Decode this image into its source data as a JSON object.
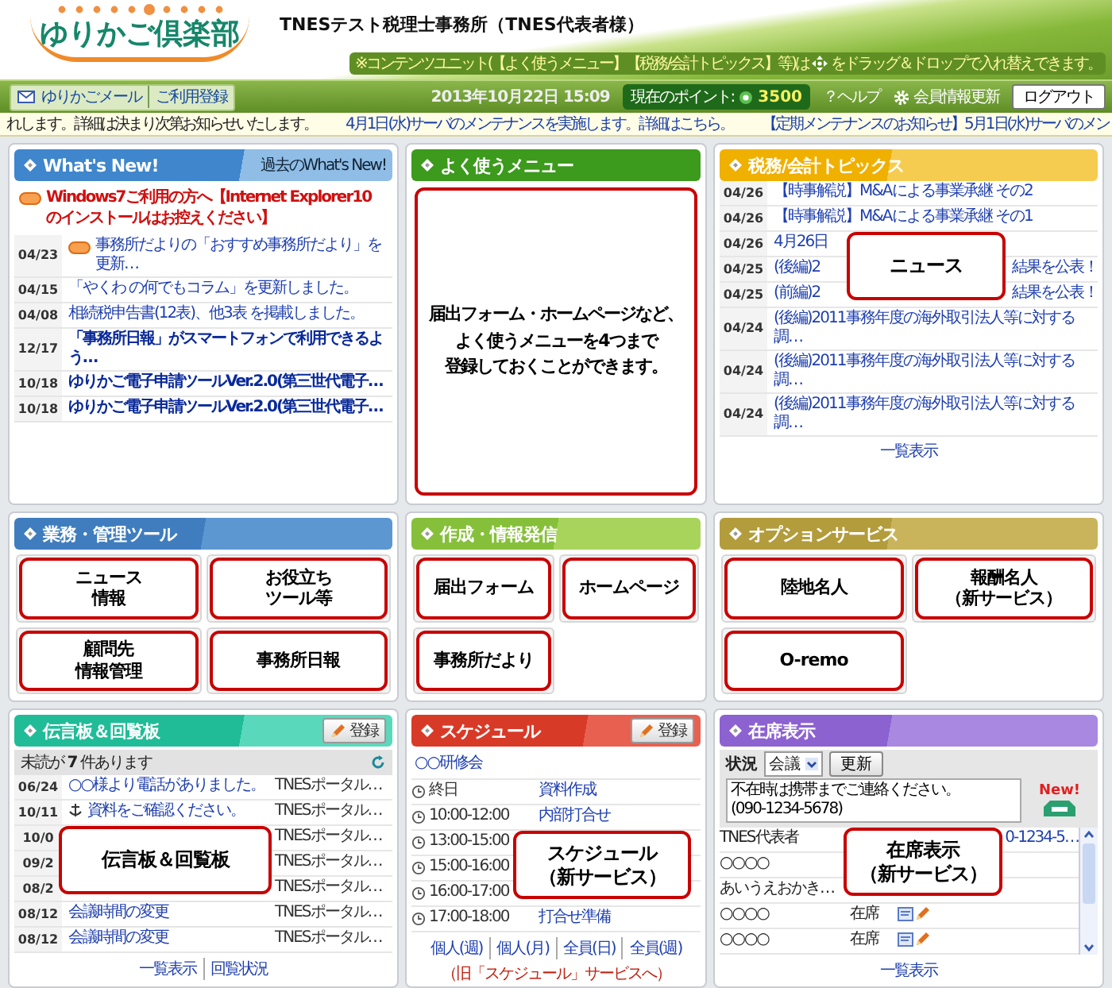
{
  "header": {
    "logo": "ゆりかご倶楽部",
    "office": "TNESテスト税理士事務所（TNES代表者様）",
    "notice_before": "※コンテンツユニット(【よく使うメニュー】【税務/会計トピックス】等)は",
    "notice_after": "をドラッグ＆ドロップで入れ替えできます。"
  },
  "nav": {
    "mail": "ゆりかごメール",
    "register": "ご利用登録",
    "datetime": "2013年10月22日 15:09",
    "points_label": "現在のポイント:",
    "points": "3500",
    "help": "？ヘルプ",
    "settings": "会員情報更新",
    "logout": "ログアウト"
  },
  "ticker": [
    {
      "text": "れします。詳細は決まり次第お知らせいたします。",
      "link": false
    },
    {
      "text": "4月1日(水)サーバのメンテナンスを実施します。詳細はこちら。",
      "link": true
    },
    {
      "text": "【定期メンテナンスのお知らせ】5月1日(水)サーバのメン",
      "link": true
    }
  ],
  "panels": [
    {
      "kind": "news",
      "title": "What's New!",
      "link": "過去のWhat's New!",
      "alert": {
        "text": "Windows7ご利用の方へ【Internet Explorer10 のインストールはお控えください】",
        "new": true
      },
      "rows": [
        {
          "date": "04/23",
          "text": "事務所だよりの「おすすめ事務所だより」を更新…",
          "new": true,
          "emphasized": false
        },
        {
          "date": "04/15",
          "text": "「やくわ の何でもコラム」を更新しました。",
          "new": false,
          "emphasized": false
        },
        {
          "date": "04/08",
          "text": "相続税申告書(12表)、他3表 を掲載しました。",
          "new": false,
          "emphasized": false
        },
        {
          "date": "12/17",
          "text": "「事務所日報」がスマートフォンで利用できるよう…",
          "new": false,
          "emphasized": true
        },
        {
          "date": "10/18",
          "text": "ゆりかご電子申請ツールVer.2.0(第三世代電子…",
          "new": false,
          "emphasized": true
        },
        {
          "date": "10/18",
          "text": "ゆりかご電子申請ツールVer.2.0(第三世代電子…",
          "new": false,
          "emphasized": true
        }
      ]
    },
    {
      "kind": "menu",
      "title": "よく使うメニュー",
      "callout": [
        "届出フォーム・ホームページなど、",
        "よく使うメニューを4つまで",
        "登録しておくことができます。"
      ]
    },
    {
      "kind": "topics",
      "title": "税務/会計トピックス",
      "more": "一覧表示",
      "rows": [
        {
          "date": "04/26",
          "text": "【時事解説】M&Aによる事業承継 その2"
        },
        {
          "date": "04/26",
          "text": "【時事解説】M&Aによる事業承継 その1"
        },
        {
          "date": "04/26",
          "text": "4月26日",
          "callout": [
            "ニュース"
          ]
        },
        {
          "date": "04/25",
          "text": "(後編)2",
          "tail": "結果を公表！"
        },
        {
          "date": "04/25",
          "text": "(前編)2",
          "tail": "結果を公表！"
        },
        {
          "date": "04/24",
          "text": "(後編)2011事務年度の海外取引法人等に対する調…"
        },
        {
          "date": "04/24",
          "text": "(後編)2011事務年度の海外取引法人等に対する調…"
        },
        {
          "date": "04/24",
          "text": "(後編)2011事務年度の海外取引法人等に対する調…"
        }
      ]
    },
    {
      "kind": "tools",
      "title": "業務・管理ツール",
      "tiles": [
        [
          "ニュース",
          "情報"
        ],
        [
          "お役立ち",
          "ツール等"
        ],
        [
          "顧問先",
          "情報管理"
        ],
        [
          "事務所日報"
        ]
      ]
    },
    {
      "kind": "tools",
      "title": "作成・情報発信",
      "tiles": [
        [
          "届出フォーム"
        ],
        [
          "ホームページ"
        ],
        [
          "事務所だより"
        ]
      ]
    },
    {
      "kind": "tools",
      "title": "オプションサービス",
      "tiles": [
        [
          "陸地名人"
        ],
        [
          "報酬名人",
          "（新サービス）"
        ],
        [
          "O-remo"
        ]
      ]
    },
    {
      "kind": "messages",
      "title": "伝言板＆回覧板",
      "button": "登録",
      "unread": "未読が **7** 件あります",
      "links": [
        "一覧表示",
        "回覧状況"
      ],
      "rows": [
        {
          "date": "06/24",
          "text": "○○様より電話がありました。",
          "from": "TNESポータル…",
          "marked": false
        },
        {
          "date": "10/11",
          "text": "資料をご確認ください。",
          "from": "TNESポータル…",
          "marked": true
        },
        {
          "date": "10/0",
          "from": "TNESポータル…",
          "marked": false,
          "callout": [
            "伝言板＆回覧板"
          ]
        },
        {
          "date": "09/2",
          "from": "TNESポータル…",
          "marked": false
        },
        {
          "date": "08/2",
          "from": "TNESポータル…",
          "marked": false
        },
        {
          "date": "08/12",
          "text": "会議時間の変更",
          "from": "TNESポータル…",
          "marked": false
        },
        {
          "date": "08/12",
          "text": "会議時間の変更",
          "from": "TNESポータル…",
          "marked": false
        }
      ]
    },
    {
      "kind": "schedule",
      "title": "スケジュール",
      "button": "登録",
      "event": "○○研修会",
      "links": [
        "個人(週)",
        "個人(月)",
        "全員(日)",
        "全員(週)"
      ],
      "legacy": "（旧「スケジュール」サービスへ）",
      "rows": [
        {
          "time": "終日",
          "text": "資料作成"
        },
        {
          "time": "10:00-12:00",
          "text": "内部打合せ"
        },
        {
          "time": "13:00-15:00",
          "callout": [
            "スケジュール",
            "（新サービス）"
          ]
        },
        {
          "time": "15:00-16:00"
        },
        {
          "time": "16:00-17:00"
        },
        {
          "time": "17:00-18:00",
          "text": "打合せ準備"
        }
      ]
    },
    {
      "kind": "presence",
      "title": "在席表示",
      "status_label": "状況",
      "status": "会議",
      "update": "更新",
      "message": "不在時は携帯までご連絡ください。\n(090-1234-5678)",
      "new_label": "New!",
      "more": "一覧表示",
      "rows": [
        {
          "name": "TNES代表者",
          "tail": "0-1234-5…",
          "callout": [
            "在席表示",
            "（新サービス）"
          ]
        },
        {
          "name": "○○○○"
        },
        {
          "name": "あいうえおかき…"
        },
        {
          "name": "○○○○",
          "status": "在席"
        },
        {
          "name": "○○○○",
          "status": "在席"
        }
      ]
    }
  ]
}
